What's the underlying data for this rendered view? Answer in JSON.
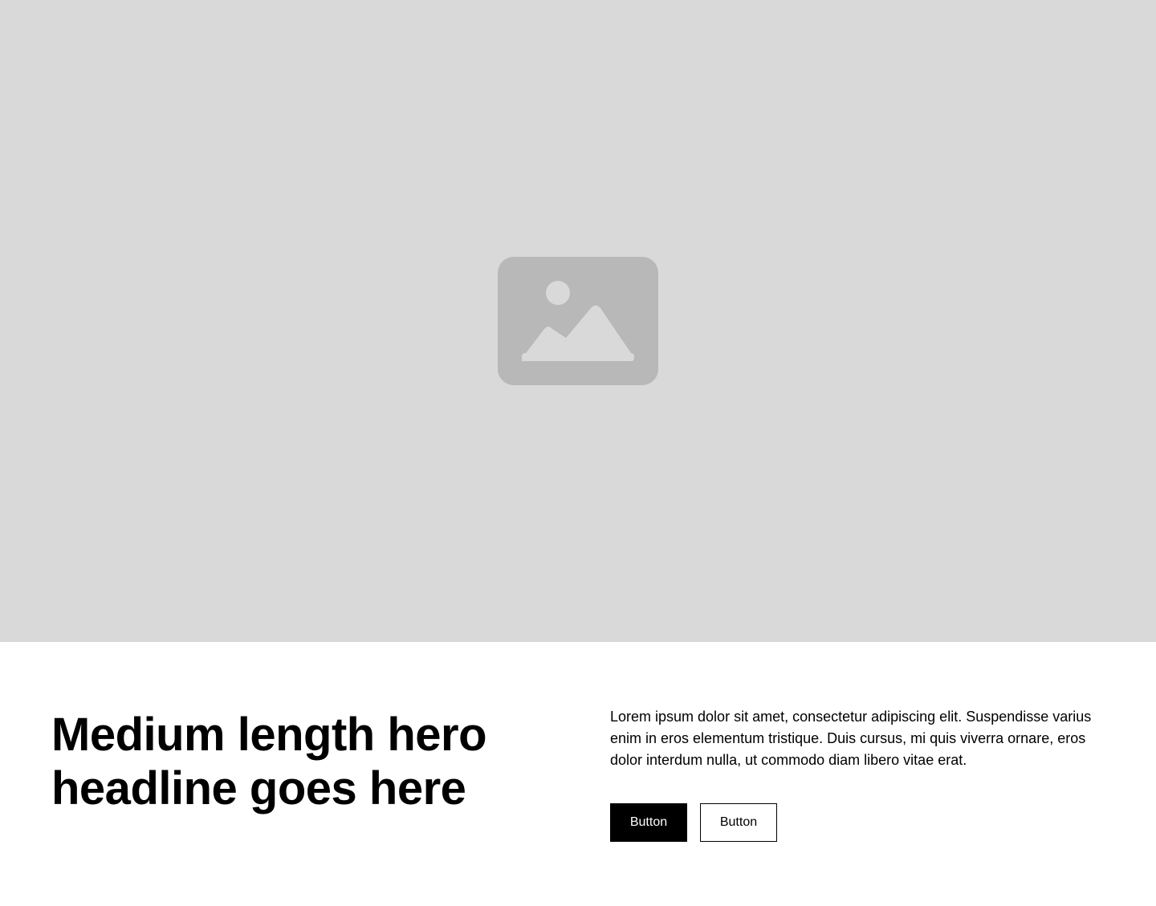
{
  "hero": {
    "image": {
      "icon": "image-placeholder-icon",
      "background_color": "#d9d9d9",
      "icon_color": "#b8b8b8"
    },
    "headline": "Medium length hero headline goes here",
    "body": "Lorem ipsum dolor sit amet, consectetur adipiscing elit. Suspendisse varius enim in eros elementum tristique. Duis cursus, mi quis viverra ornare, eros dolor interdum nulla, ut commodo diam libero vitae erat.",
    "buttons": {
      "primary_label": "Button",
      "secondary_label": "Button"
    }
  }
}
